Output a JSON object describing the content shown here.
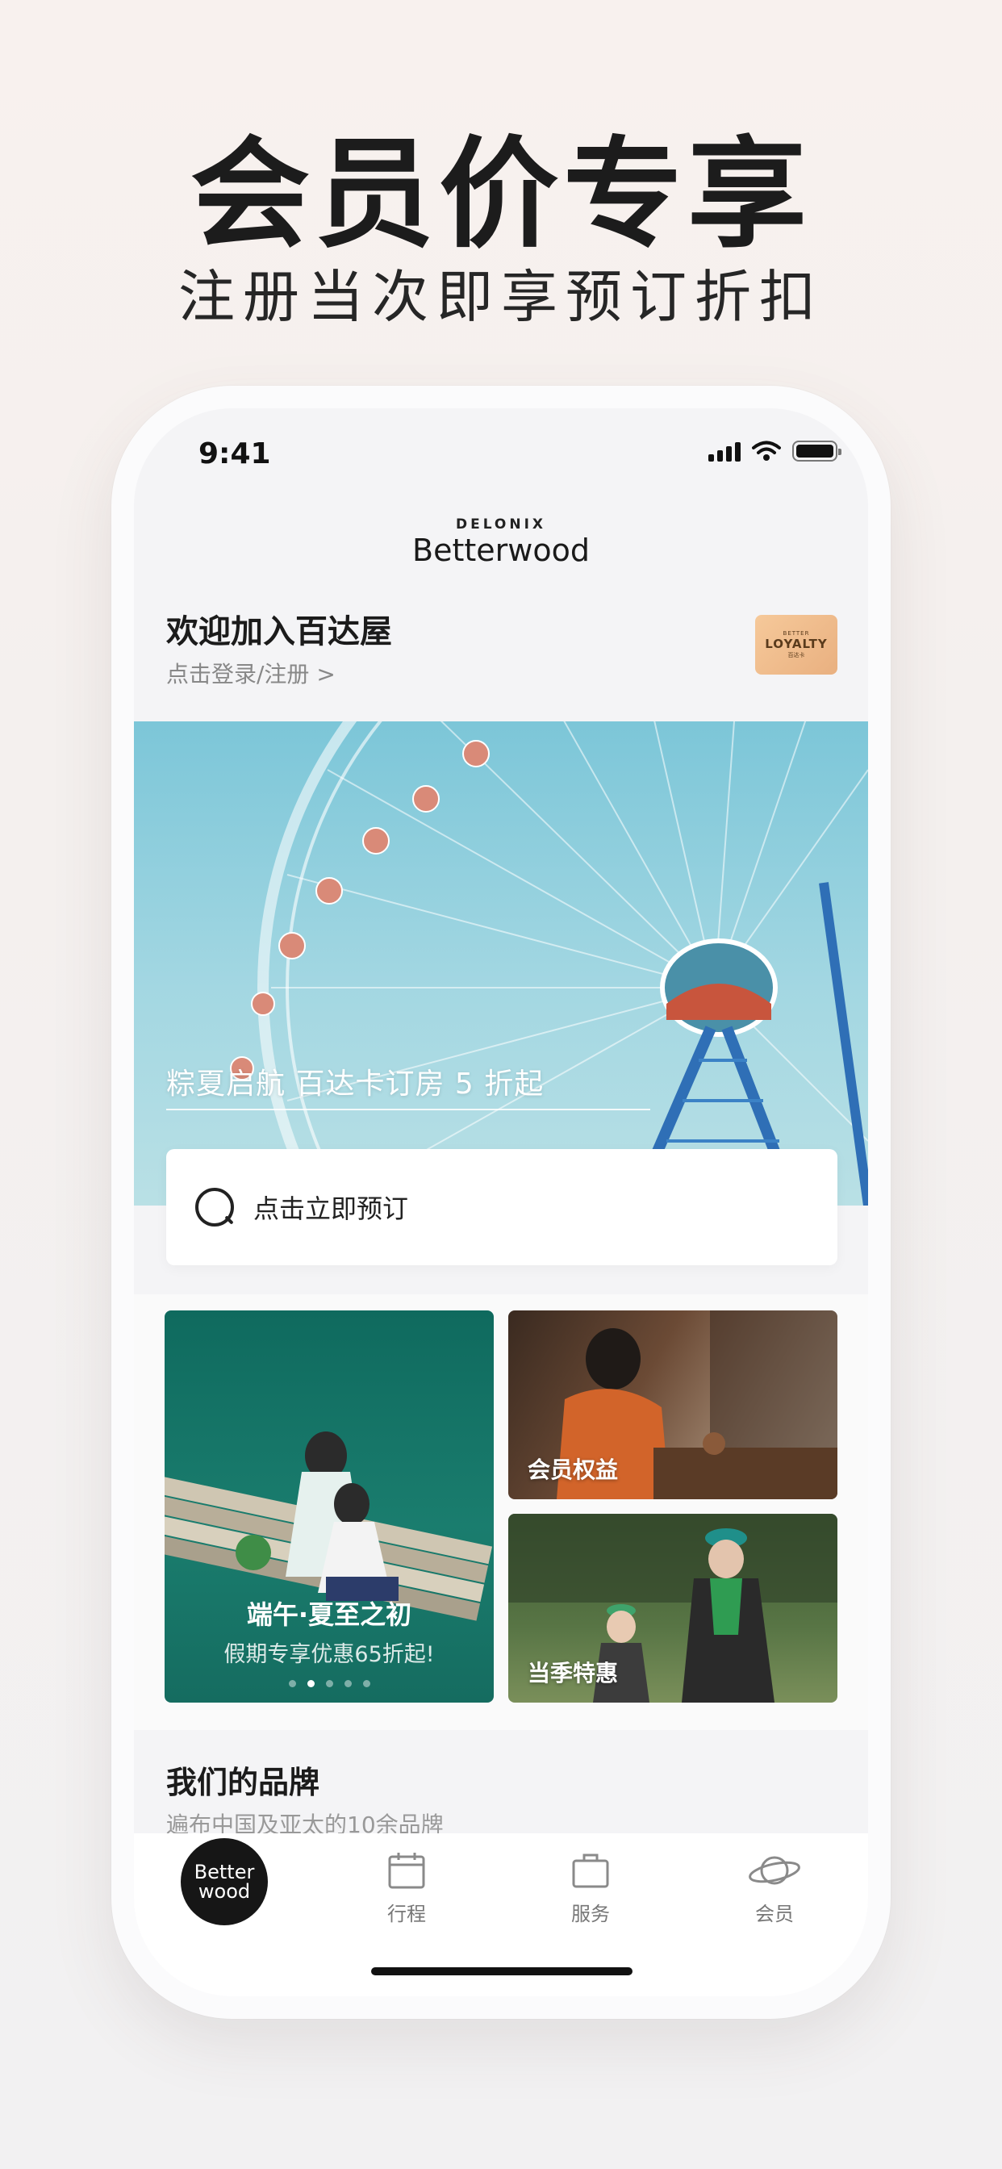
{
  "promo": {
    "title": "会员价专享",
    "subtitle": "注册当次即享预订折扣"
  },
  "status_bar": {
    "time": "9:41"
  },
  "brand": {
    "small": "DELONIX",
    "main": "Betterwood"
  },
  "header": {
    "welcome": "欢迎加入百达屋",
    "login_link": "点击登录/注册 >",
    "loyalty_card": {
      "line1": "BETTER",
      "line2": "LOYALTY",
      "line3": "百达卡"
    }
  },
  "banner": {
    "caption": "粽夏启航 百达卡订房 5 折起"
  },
  "search": {
    "placeholder": "点击立即预订"
  },
  "cards": {
    "main": {
      "title": "端午·夏至之初",
      "subtitle": "假期专享优惠65折起!"
    },
    "member_benefits": "会员权益",
    "seasonal_deals": "当季特惠"
  },
  "brands": {
    "title": "我们的品牌",
    "subtitle": "遍布中国及亚太的10余品牌"
  },
  "tabbar": {
    "home": {
      "line1": "Better",
      "line2": "wood"
    },
    "trips": "行程",
    "services": "服务",
    "member": "会员"
  },
  "colors": {
    "accent": "#161616",
    "loyalty": "#f1bd8c",
    "banner_sky": "#8fcfdd",
    "card_green": "#156c60"
  }
}
